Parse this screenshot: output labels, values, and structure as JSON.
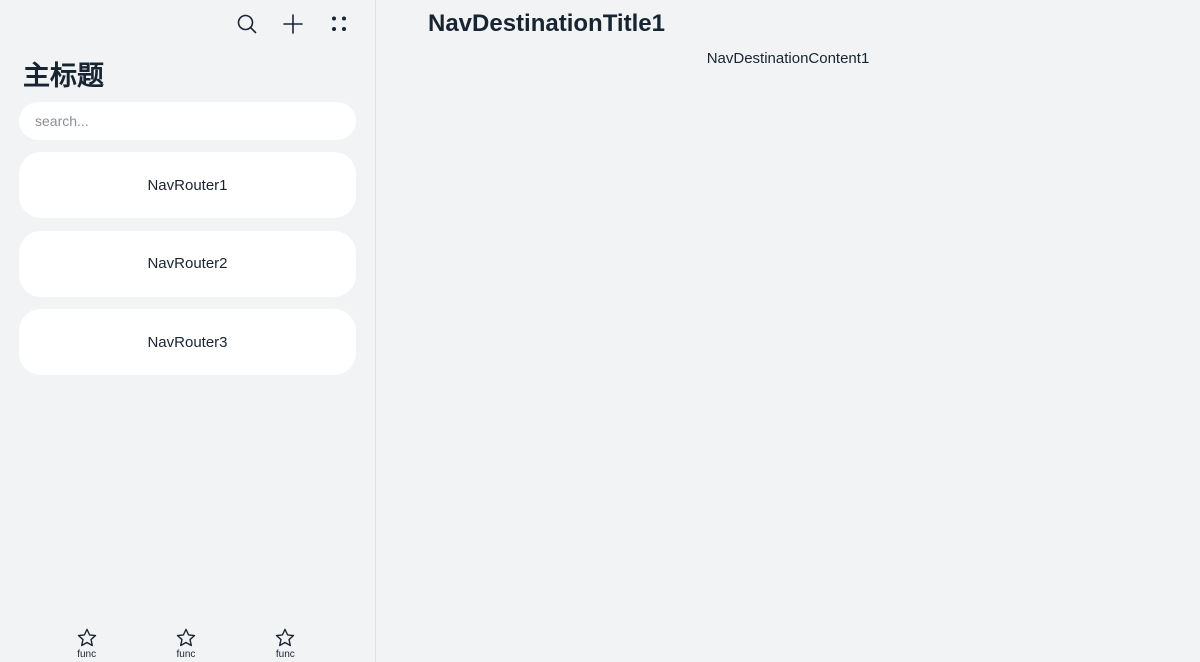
{
  "navigation": {
    "title": "主标题",
    "search": {
      "placeholder": "search...",
      "value": ""
    },
    "menus": [
      {
        "icon": "search-icon"
      },
      {
        "icon": "plus-icon"
      },
      {
        "icon": "more-dots-icon"
      }
    ],
    "routers": [
      {
        "label": "NavRouter1"
      },
      {
        "label": "NavRouter2"
      },
      {
        "label": "NavRouter3"
      }
    ],
    "toolbar": [
      {
        "label": "func",
        "icon": "star-icon"
      },
      {
        "label": "func",
        "icon": "star-icon"
      },
      {
        "label": "func",
        "icon": "star-icon"
      }
    ]
  },
  "destination": {
    "title": "NavDestinationTitle1",
    "content": "NavDestinationContent1"
  },
  "colors": {
    "background": "#f1f3f5",
    "card": "#ffffff",
    "text": "#182431",
    "divider": "#dfe2e5"
  }
}
